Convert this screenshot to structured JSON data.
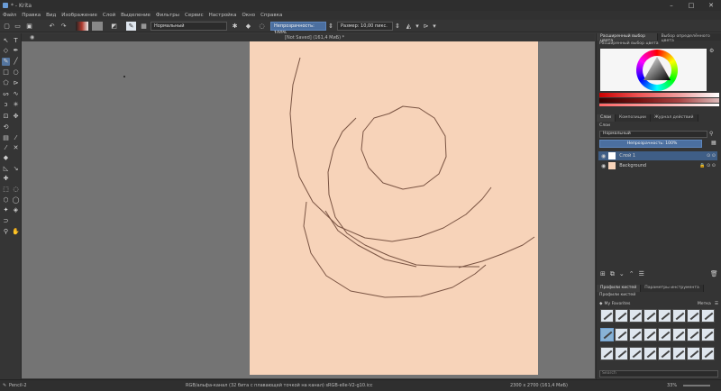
{
  "window": {
    "title": "* - Krita",
    "minimize": "–",
    "maximize": "□",
    "close": "✕"
  },
  "menu": [
    "Файл",
    "Правка",
    "Вид",
    "Изображение",
    "Слой",
    "Выделение",
    "Фильтры",
    "Сервис",
    "Настройка",
    "Окно",
    "Справка"
  ],
  "toolbar": {
    "blend_mode": "Нормальный",
    "opacity": "Непрозрачность: 100%",
    "size": "Размер: 10,00 пикс."
  },
  "document": {
    "tab": "[Not Saved]  (161,4 МиБ) *"
  },
  "dock": {
    "top_tabs": [
      "Расширенный выбор цвета",
      "Выбор определённого цвета"
    ],
    "color_header": "Расширенный выбор цвета",
    "layer_tabs": [
      "Слои",
      "Композиции",
      "Журнал действий"
    ],
    "layers_label": "Слои",
    "layers_blend": "Нормальный",
    "layers_opacity": "Непрозрачность: 100%",
    "layers": [
      {
        "name": "Слой 1"
      },
      {
        "name": "Background"
      }
    ],
    "brush_tabs": [
      "Профили кистей",
      "Параметры инструмента"
    ],
    "brush_header": "Профили кистей",
    "brush_tag": "My Favorites",
    "brush_tag_right": "Метка",
    "search_placeholder": "Search"
  },
  "status": {
    "brush": "Pencil-2",
    "colorspace": "RGB/альфа-канал (32 бита с плавающей точкой на канал)  sRGB-elle-V2-g10.icc",
    "size": "2300 x 2700 (161,4 МиБ)",
    "zoom": "33%"
  },
  "colors": {
    "paper": "#f7d3b9",
    "stroke": "#7a5443",
    "accent": "#54759f"
  }
}
